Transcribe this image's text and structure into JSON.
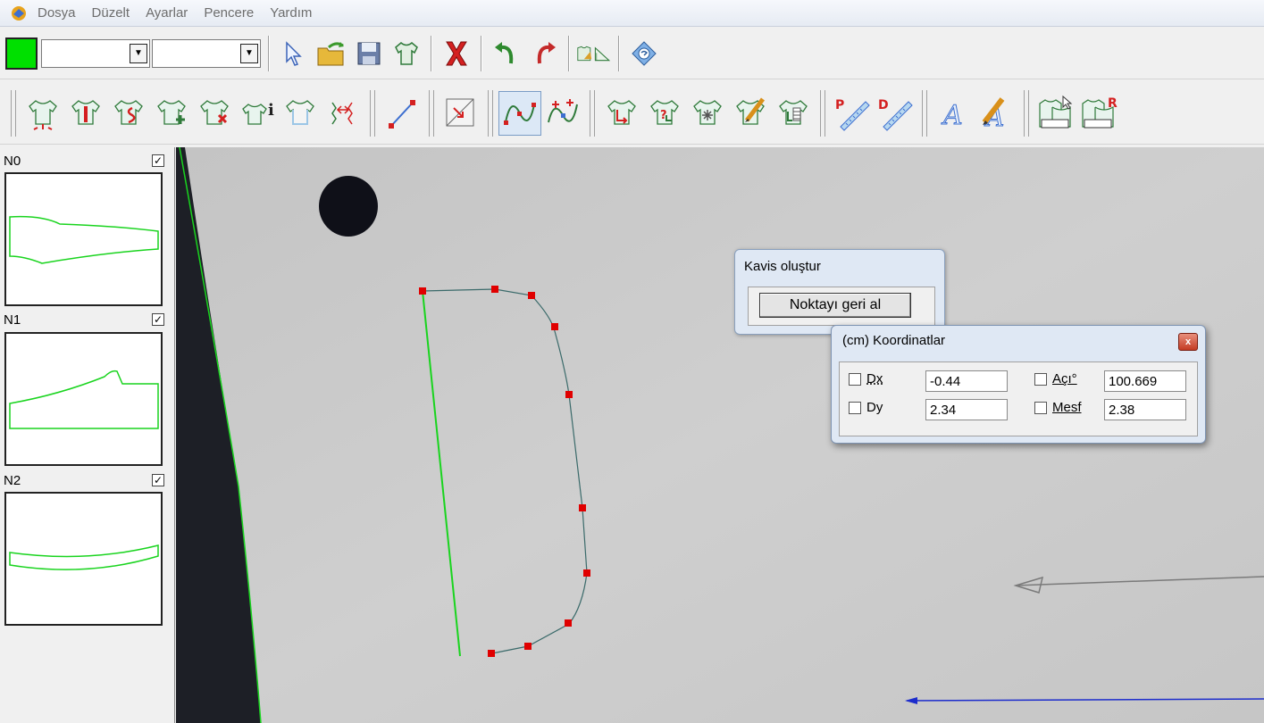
{
  "menu": {
    "items": [
      "Dosya",
      "Düzelt",
      "Ayarlar",
      "Pencere",
      "Yardım"
    ]
  },
  "toolbar1": {
    "color_swatch": "#00e000",
    "combo1_value": "",
    "combo2_value": "",
    "icons": [
      "select-arrow-icon",
      "open-folder-icon",
      "save-icon",
      "shirt-icon",
      "delete-x-icon",
      "undo-icon",
      "redo-icon",
      "measure-icon",
      "info-icon"
    ]
  },
  "toolbar2": {
    "icons": [
      "piece-new-icon",
      "piece-split-icon",
      "piece-curve-icon",
      "piece-add-icon",
      "piece-delete-icon",
      "piece-info-icon",
      "piece-outline-icon",
      "piece-mirror-icon",
      "line-icon",
      "scale-icon",
      "curve-icon",
      "curve-points-icon",
      "notch-icon",
      "notch-query-icon",
      "notch-delete-icon",
      "notch-edit-icon",
      "notch-table-icon",
      "ruler-p-icon",
      "ruler-d-icon",
      "text-icon",
      "text-edit-icon",
      "dxdy-point-icon",
      "dxdy-r-icon"
    ],
    "ruler_p": "P",
    "ruler_d": "D",
    "dxdy_r": "R"
  },
  "pieces": [
    {
      "label": "N0",
      "checked": true
    },
    {
      "label": "N1",
      "checked": true
    },
    {
      "label": "N2",
      "checked": true
    }
  ],
  "kavis_dialog": {
    "title": "Kavis oluştur",
    "button": "Noktayı geri al"
  },
  "koordinatlar_dialog": {
    "title": "(cm) Koordinatlar",
    "close": "x",
    "dx_label": "Dx",
    "dx_value": "-0.44",
    "dy_label": "Dy",
    "dy_value": "2.34",
    "aci_label": "Açı°",
    "aci_value": "100.669",
    "mesf_label": "Mesf",
    "mesf_value": "2.38"
  },
  "colors": {
    "piece_outline": "#19d41e",
    "curve_point": "#e00000",
    "curve_line": "#3a6a6a",
    "arrow_blue": "#1c2ccc"
  }
}
